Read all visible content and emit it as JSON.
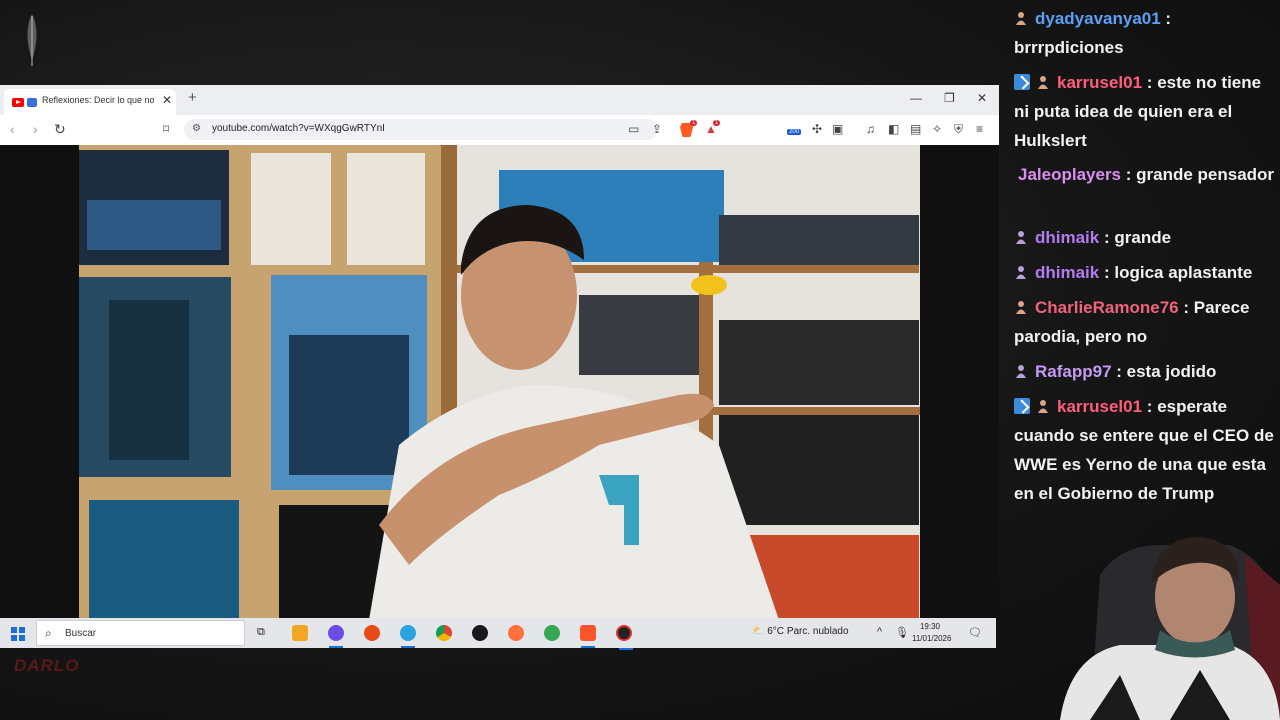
{
  "browser": {
    "tab_title": "Reflexiones: Decir lo que no q",
    "url": "youtube.com/watch?v=WXqgGwRTYnI",
    "badge_count": "1",
    "extension_badge": "200"
  },
  "taskbar": {
    "search_placeholder": "Buscar",
    "weather_temp": "6°C",
    "weather_desc": "Parc. nublado",
    "time": "19:30",
    "date": "11/01/2026"
  },
  "chat": {
    "messages": [
      {
        "user": "dyadyavanya01",
        "sep": " : ",
        "text": "brrrpdiciones",
        "user_color": "#5aa0f5",
        "prime": false
      },
      {
        "user": "karrusel01",
        "sep": " : ",
        "text": "este no tiene ni puta idea de quien era el Hulkslert",
        "user_color": "#ff5d7a",
        "prime": true
      },
      {
        "user": "Jaleoplayers",
        "sep": " : ",
        "text": "grande pensador",
        "user_color": "#d98ef0",
        "prime": false
      },
      {
        "user": "dhimaik",
        "sep": " : ",
        "text": "grande",
        "user_color": "#b27bf0",
        "prime": false
      },
      {
        "user": "dhimaik",
        "sep": " : ",
        "text": "logica aplastante",
        "user_color": "#b27bf0",
        "prime": false
      },
      {
        "user": "CharlieRamone76",
        "sep": " : ",
        "text": "Parece parodia, pero no",
        "user_color": "#f0637d",
        "prime": false
      },
      {
        "user": "Rafapp97",
        "sep": " : ",
        "text": "esta jodido",
        "user_color": "#c49af5",
        "prime": false
      },
      {
        "user": "karrusel01",
        "sep": " : ",
        "text": "esperate cuando se entere que el CEO de WWE es Yerno de una que esta en el Gobierno de Trump",
        "user_color": "#ff5d7a",
        "prime": true
      }
    ]
  },
  "colors": {
    "accent_blue": "#1b6fd6",
    "youtube_red": "#ff0000",
    "brave_orange": "#ff5a1f"
  }
}
